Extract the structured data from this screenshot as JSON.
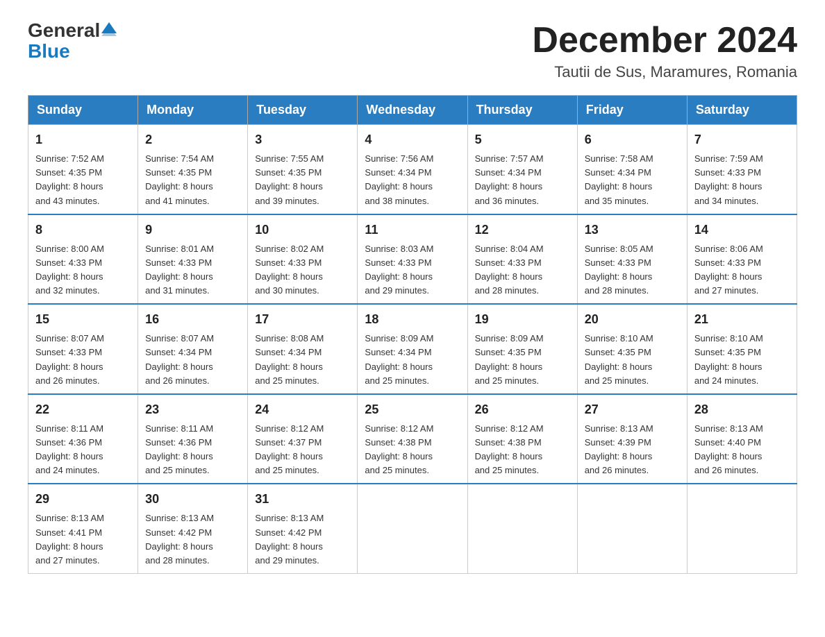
{
  "header": {
    "logo_line1": "General",
    "logo_line2": "Blue",
    "title": "December 2024",
    "subtitle": "Tautii de Sus, Maramures, Romania"
  },
  "days_of_week": [
    "Sunday",
    "Monday",
    "Tuesday",
    "Wednesday",
    "Thursday",
    "Friday",
    "Saturday"
  ],
  "weeks": [
    [
      {
        "day": "1",
        "sunrise": "7:52 AM",
        "sunset": "4:35 PM",
        "daylight": "8 hours and 43 minutes."
      },
      {
        "day": "2",
        "sunrise": "7:54 AM",
        "sunset": "4:35 PM",
        "daylight": "8 hours and 41 minutes."
      },
      {
        "day": "3",
        "sunrise": "7:55 AM",
        "sunset": "4:35 PM",
        "daylight": "8 hours and 39 minutes."
      },
      {
        "day": "4",
        "sunrise": "7:56 AM",
        "sunset": "4:34 PM",
        "daylight": "8 hours and 38 minutes."
      },
      {
        "day": "5",
        "sunrise": "7:57 AM",
        "sunset": "4:34 PM",
        "daylight": "8 hours and 36 minutes."
      },
      {
        "day": "6",
        "sunrise": "7:58 AM",
        "sunset": "4:34 PM",
        "daylight": "8 hours and 35 minutes."
      },
      {
        "day": "7",
        "sunrise": "7:59 AM",
        "sunset": "4:33 PM",
        "daylight": "8 hours and 34 minutes."
      }
    ],
    [
      {
        "day": "8",
        "sunrise": "8:00 AM",
        "sunset": "4:33 PM",
        "daylight": "8 hours and 32 minutes."
      },
      {
        "day": "9",
        "sunrise": "8:01 AM",
        "sunset": "4:33 PM",
        "daylight": "8 hours and 31 minutes."
      },
      {
        "day": "10",
        "sunrise": "8:02 AM",
        "sunset": "4:33 PM",
        "daylight": "8 hours and 30 minutes."
      },
      {
        "day": "11",
        "sunrise": "8:03 AM",
        "sunset": "4:33 PM",
        "daylight": "8 hours and 29 minutes."
      },
      {
        "day": "12",
        "sunrise": "8:04 AM",
        "sunset": "4:33 PM",
        "daylight": "8 hours and 28 minutes."
      },
      {
        "day": "13",
        "sunrise": "8:05 AM",
        "sunset": "4:33 PM",
        "daylight": "8 hours and 28 minutes."
      },
      {
        "day": "14",
        "sunrise": "8:06 AM",
        "sunset": "4:33 PM",
        "daylight": "8 hours and 27 minutes."
      }
    ],
    [
      {
        "day": "15",
        "sunrise": "8:07 AM",
        "sunset": "4:33 PM",
        "daylight": "8 hours and 26 minutes."
      },
      {
        "day": "16",
        "sunrise": "8:07 AM",
        "sunset": "4:34 PM",
        "daylight": "8 hours and 26 minutes."
      },
      {
        "day": "17",
        "sunrise": "8:08 AM",
        "sunset": "4:34 PM",
        "daylight": "8 hours and 25 minutes."
      },
      {
        "day": "18",
        "sunrise": "8:09 AM",
        "sunset": "4:34 PM",
        "daylight": "8 hours and 25 minutes."
      },
      {
        "day": "19",
        "sunrise": "8:09 AM",
        "sunset": "4:35 PM",
        "daylight": "8 hours and 25 minutes."
      },
      {
        "day": "20",
        "sunrise": "8:10 AM",
        "sunset": "4:35 PM",
        "daylight": "8 hours and 25 minutes."
      },
      {
        "day": "21",
        "sunrise": "8:10 AM",
        "sunset": "4:35 PM",
        "daylight": "8 hours and 24 minutes."
      }
    ],
    [
      {
        "day": "22",
        "sunrise": "8:11 AM",
        "sunset": "4:36 PM",
        "daylight": "8 hours and 24 minutes."
      },
      {
        "day": "23",
        "sunrise": "8:11 AM",
        "sunset": "4:36 PM",
        "daylight": "8 hours and 25 minutes."
      },
      {
        "day": "24",
        "sunrise": "8:12 AM",
        "sunset": "4:37 PM",
        "daylight": "8 hours and 25 minutes."
      },
      {
        "day": "25",
        "sunrise": "8:12 AM",
        "sunset": "4:38 PM",
        "daylight": "8 hours and 25 minutes."
      },
      {
        "day": "26",
        "sunrise": "8:12 AM",
        "sunset": "4:38 PM",
        "daylight": "8 hours and 25 minutes."
      },
      {
        "day": "27",
        "sunrise": "8:13 AM",
        "sunset": "4:39 PM",
        "daylight": "8 hours and 26 minutes."
      },
      {
        "day": "28",
        "sunrise": "8:13 AM",
        "sunset": "4:40 PM",
        "daylight": "8 hours and 26 minutes."
      }
    ],
    [
      {
        "day": "29",
        "sunrise": "8:13 AM",
        "sunset": "4:41 PM",
        "daylight": "8 hours and 27 minutes."
      },
      {
        "day": "30",
        "sunrise": "8:13 AM",
        "sunset": "4:42 PM",
        "daylight": "8 hours and 28 minutes."
      },
      {
        "day": "31",
        "sunrise": "8:13 AM",
        "sunset": "4:42 PM",
        "daylight": "8 hours and 29 minutes."
      },
      null,
      null,
      null,
      null
    ]
  ],
  "labels": {
    "sunrise": "Sunrise: ",
    "sunset": "Sunset: ",
    "daylight": "Daylight: "
  }
}
